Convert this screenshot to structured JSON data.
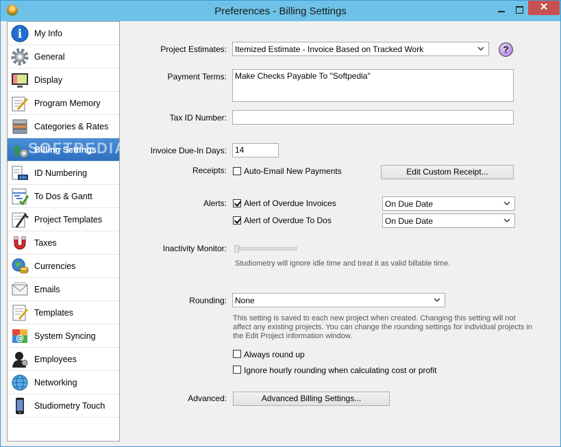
{
  "window": {
    "title": "Preferences - Billing Settings"
  },
  "sidebar": {
    "items": [
      {
        "label": "My Info",
        "icon": "info-icon"
      },
      {
        "label": "General",
        "icon": "gear-icon"
      },
      {
        "label": "Display",
        "icon": "monitor-icon"
      },
      {
        "label": "Program Memory",
        "icon": "memory-icon"
      },
      {
        "label": "Categories & Rates",
        "icon": "categories-icon"
      },
      {
        "label": "Billing Settings",
        "icon": "billing-icon",
        "selected": true
      },
      {
        "label": "ID Numbering",
        "icon": "id-numbering-icon"
      },
      {
        "label": "To Dos & Gantt",
        "icon": "todo-icon"
      },
      {
        "label": "Project Templates",
        "icon": "project-templates-icon"
      },
      {
        "label": "Taxes",
        "icon": "taxes-icon"
      },
      {
        "label": "Currencies",
        "icon": "currencies-icon"
      },
      {
        "label": "Emails",
        "icon": "email-icon"
      },
      {
        "label": "Templates",
        "icon": "templates-icon"
      },
      {
        "label": "System Syncing",
        "icon": "sync-icon"
      },
      {
        "label": "Employees",
        "icon": "employees-icon"
      },
      {
        "label": "Networking",
        "icon": "network-icon"
      },
      {
        "label": "Studiometry Touch",
        "icon": "phone-icon"
      }
    ]
  },
  "form": {
    "project_estimates": {
      "label": "Project Estimates:",
      "value": "Itemized Estimate - Invoice Based on Tracked Work",
      "help": "?"
    },
    "payment_terms": {
      "label": "Payment Terms:",
      "value": "Make Checks Payable To \"Softpedia\""
    },
    "tax_id": {
      "label": "Tax ID Number:",
      "value": ""
    },
    "invoice_due": {
      "label": "Invoice Due-In Days:",
      "value": "14"
    },
    "receipts": {
      "label": "Receipts:",
      "auto_email": "Auto-Email New Payments",
      "auto_email_checked": false,
      "edit_button": "Edit Custom Receipt..."
    },
    "alerts": {
      "label": "Alerts:",
      "overdue_invoices": "Alert of Overdue Invoices",
      "overdue_invoices_checked": true,
      "overdue_invoices_when": "On Due Date",
      "overdue_todos": "Alert of Overdue To Dos",
      "overdue_todos_checked": true,
      "overdue_todos_when": "On Due Date"
    },
    "inactivity": {
      "label": "Inactivity Monitor:",
      "level": 0,
      "note": "Studiometry will ignore idle time and treat it as valid billable time."
    },
    "rounding": {
      "label": "Rounding:",
      "value": "None",
      "note": "This setting is saved to each new project when created. Changing this setting will not affect any existing projects. You can change the rounding settings for individual projects in the Edit Project information window.",
      "always_round_up": "Always round up",
      "always_round_up_checked": false,
      "ignore_hourly": "Ignore hourly rounding when calculating cost or profit",
      "ignore_hourly_checked": false
    },
    "advanced": {
      "label": "Advanced:",
      "button": "Advanced Billing Settings..."
    }
  },
  "watermark": "SOFTPEDIA",
  "colors": {
    "titlebar": "#6ec2e8",
    "selected": "#3a7cc8",
    "close": "#c75050"
  }
}
